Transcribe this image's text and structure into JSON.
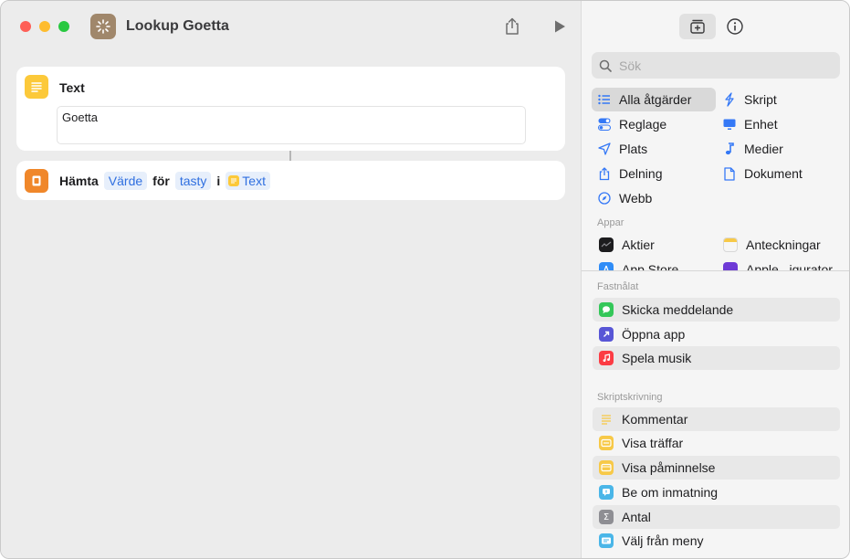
{
  "window": {
    "title": "Lookup Goetta"
  },
  "editor": {
    "text_action": {
      "title": "Text",
      "content": "Goetta"
    },
    "get_action": {
      "verb": "Hämta",
      "value_token": "Värde",
      "for_word": "för",
      "key_token": "tasty",
      "in_word": "i",
      "dict_token": "Text"
    }
  },
  "sidebar": {
    "search": {
      "placeholder": "Sök"
    },
    "categories": [
      {
        "label": "Alla åtgärder",
        "icon": "list-icon"
      },
      {
        "label": "Skript",
        "icon": "script-icon"
      },
      {
        "label": "Reglage",
        "icon": "toggle-icon"
      },
      {
        "label": "Enhet",
        "icon": "display-icon"
      },
      {
        "label": "Plats",
        "icon": "location-arrow-icon"
      },
      {
        "label": "Medier",
        "icon": "music-note-icon"
      },
      {
        "label": "Delning",
        "icon": "share-icon"
      },
      {
        "label": "Dokument",
        "icon": "document-icon"
      },
      {
        "label": "Webb",
        "icon": "compass-icon"
      }
    ],
    "apps_label": "Appar",
    "apps": [
      {
        "label": "Aktier",
        "icon": "stocks-icon"
      },
      {
        "label": "Anteckningar",
        "icon": "notes-icon"
      },
      {
        "label": "App Store",
        "icon": "app-store-icon"
      },
      {
        "label": "Apple...igurator",
        "icon": "configurator-icon"
      }
    ],
    "pinned_label": "Fastnålat",
    "pinned": [
      {
        "label": "Skicka meddelande",
        "icon": "message-icon",
        "color": "#34c759"
      },
      {
        "label": "Öppna app",
        "icon": "open-app-icon",
        "color": "#5856d6"
      },
      {
        "label": "Spela musik",
        "icon": "music-icon",
        "color": "#fc3c44"
      }
    ],
    "scripting_label": "Skriptskrivning",
    "scripting": [
      {
        "label": "Kommentar",
        "icon": "comment-lines-icon",
        "color": "#f7c948"
      },
      {
        "label": "Visa träffar",
        "icon": "show-results-icon",
        "color": "#f7c948"
      },
      {
        "label": "Visa påminnelse",
        "icon": "alert-icon",
        "color": "#f7c948"
      },
      {
        "label": "Be om inmatning",
        "icon": "ask-input-icon",
        "color": "#4ab6e8"
      },
      {
        "label": "Antal",
        "icon": "sigma-icon",
        "color": "#8e8e93"
      },
      {
        "label": "Välj från meny",
        "icon": "menu-icon",
        "color": "#4ab6e8"
      }
    ]
  }
}
